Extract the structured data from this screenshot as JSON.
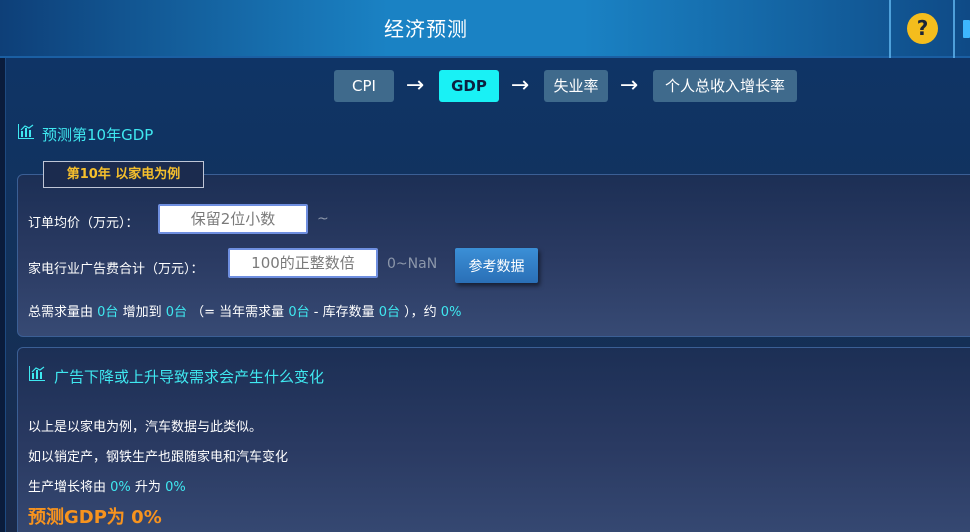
{
  "header": {
    "title": "经济预测",
    "help_label": "?"
  },
  "steps": [
    {
      "label": "CPI",
      "active": false
    },
    {
      "label": "GDP",
      "active": true
    },
    {
      "label": "失业率",
      "active": false
    },
    {
      "label": "个人总收入增长率",
      "active": false
    }
  ],
  "arrow_glyph": "→",
  "section1": {
    "title": "预测第10年GDP",
    "tag": "第10年 以家电为例",
    "order_price": {
      "label": "订单均价（万元）：",
      "placeholder": "保留2位小数",
      "hint": "~"
    },
    "ad_cost": {
      "label": "家电行业广告费合计（万元）：",
      "placeholder": "100的正整数倍",
      "hint": "0~NaN"
    },
    "ref_button": "参考数据",
    "demand": {
      "p1": "总需求量由",
      "from": "0台",
      "p2": "增加到",
      "to": "0台",
      "p3": "（= 当年需求量",
      "current": "0台",
      "p4": "- 库存数量",
      "stock": "0台",
      "p5": "），约",
      "pct": "0%"
    }
  },
  "section2": {
    "title": "广告下降或上升导致需求会产生什么变化",
    "line1": "以上是以家电为例，汽车数据与此类似。",
    "line2": "如以销定产，钢铁生产也跟随家电和汽车变化",
    "growth": {
      "p1": "生产增长将由",
      "from": "0%",
      "p2": "升为",
      "to": "0%"
    },
    "result": "预测GDP为 0%"
  },
  "colors": {
    "accent": "#3fe8f0",
    "orange": "#f7931e",
    "gold": "#f6c02c"
  }
}
